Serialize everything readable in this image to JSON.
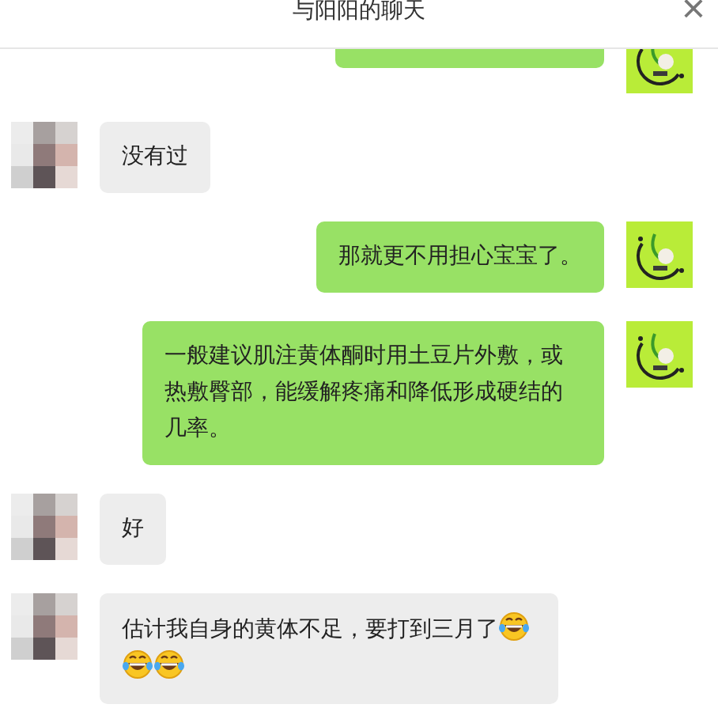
{
  "header": {
    "title": "与阳阳的聊天",
    "close": "×"
  },
  "messages": [
    {
      "kind": "sent_partial"
    },
    {
      "kind": "received",
      "parts": [
        {
          "kind": "text",
          "text": "没有过"
        }
      ]
    },
    {
      "kind": "sent",
      "parts": [
        {
          "kind": "text",
          "text": "那就更不用担心宝宝了。"
        }
      ]
    },
    {
      "kind": "sent",
      "parts": [
        {
          "kind": "text",
          "text": "一般建议肌注黄体酮时用土豆片外敷，或热敷臀部，能缓解疼痛和降低形成硬结的几率。"
        }
      ]
    },
    {
      "kind": "received",
      "parts": [
        {
          "kind": "text",
          "text": "好"
        }
      ]
    },
    {
      "kind": "received",
      "parts": [
        {
          "kind": "text",
          "text": "估计我自身的黄体不足，要打到三月了"
        },
        {
          "kind": "emoji"
        },
        {
          "kind": "emoji"
        },
        {
          "kind": "emoji"
        }
      ]
    }
  ]
}
